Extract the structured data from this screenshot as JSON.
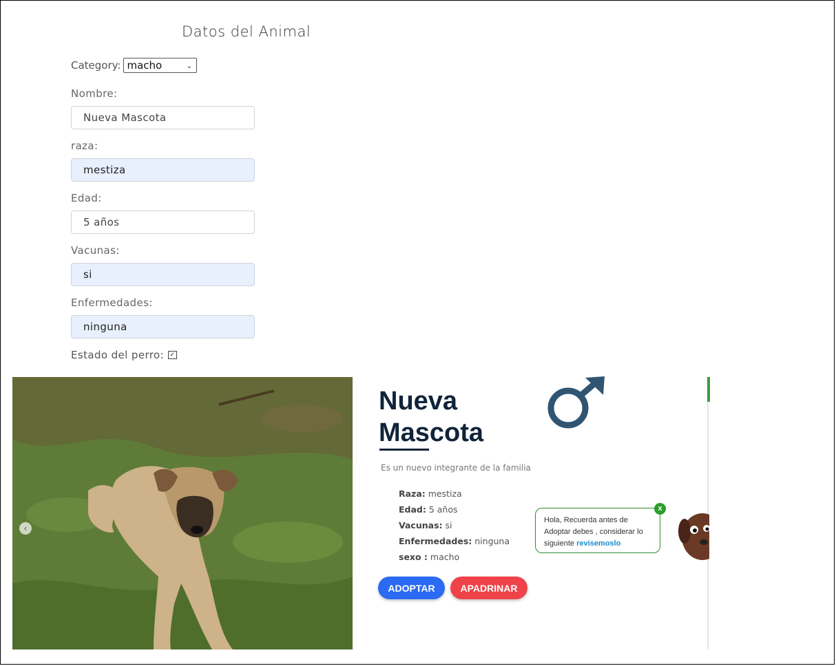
{
  "form": {
    "title": "Datos del Animal",
    "category_label": "Category:",
    "category_value": "macho",
    "fields": [
      {
        "label": "Nombre:",
        "value": "Nueva Mascota"
      },
      {
        "label": "raza:",
        "value": "mestiza"
      },
      {
        "label": "Edad:",
        "value": "5  años"
      },
      {
        "label": "Vacunas:",
        "value": "si"
      },
      {
        "label": "Enfermedades:",
        "value": "ninguna"
      }
    ],
    "estado_label": "Estado del perro:",
    "estado_checked": true
  },
  "card": {
    "name_line1": "Nueva",
    "name_line2": "Mascota",
    "tagline": "Es un nuevo integrante de la familia",
    "details": [
      {
        "key": "Raza:",
        "value": " mestiza"
      },
      {
        "key": "Edad:",
        "value": " 5 años"
      },
      {
        "key": "Vacunas:",
        "value": " si"
      },
      {
        "key": "Enfermedades:",
        "value": " ninguna"
      },
      {
        "key": "sexo :",
        "value": " macho"
      }
    ],
    "buttons": {
      "adopt": "ADOPTAR",
      "sponsor": "APADRINAR"
    },
    "gender_icon": "male-icon"
  },
  "tooltip": {
    "text": "Hola, Recuerda antes de Adoptar debes , considerar lo siguiente",
    "link": "revisemoslo",
    "close": "x"
  },
  "colors": {
    "adopt": "#2b6af3",
    "sponsor": "#ef4349",
    "title": "#10233a",
    "male_icon": "#2f5573",
    "tooltip_border": "#2e8b2e"
  }
}
